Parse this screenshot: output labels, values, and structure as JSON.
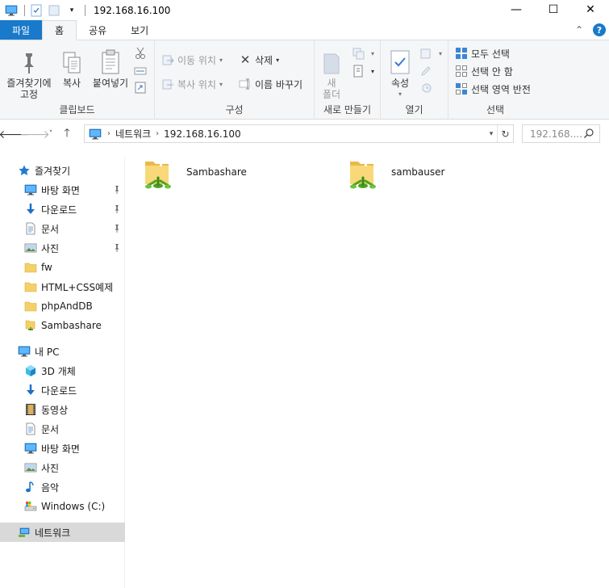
{
  "titlebar": {
    "title": "192.168.16.100",
    "minimize": "—",
    "maximize": "☐",
    "close": "✕"
  },
  "tabs": {
    "file": "파일",
    "home": "홈",
    "share": "공유",
    "view": "보기",
    "collapse": "⌃",
    "help": "?"
  },
  "ribbon": {
    "clipboard": {
      "label": "클립보드",
      "pin_line1": "즐겨찾기에",
      "pin_line2": "고정",
      "copy": "복사",
      "paste": "붙여넣기"
    },
    "organize": {
      "label": "구성",
      "move_to": "이동 위치",
      "copy_to": "복사 위치",
      "delete": "삭제",
      "rename": "이름 바꾸기"
    },
    "new": {
      "label": "새로 만들기",
      "new_folder_line1": "새",
      "new_folder_line2": "폴더"
    },
    "open": {
      "label": "열기",
      "properties": "속성"
    },
    "select": {
      "label": "선택",
      "select_all": "모두 선택",
      "select_none": "선택 안 함",
      "invert": "선택 영역 반전"
    }
  },
  "address": {
    "crumbs": [
      "네트워크",
      "192.168.16.100"
    ],
    "search_placeholder": "192.168...."
  },
  "navpane": {
    "quick_access": "즐겨찾기",
    "quick_items": [
      "바탕 화면",
      "다운로드",
      "문서",
      "사진",
      "fw",
      "HTML+CSS예제",
      "phpAndDB",
      "Sambashare"
    ],
    "this_pc": "내 PC",
    "pc_items": [
      "3D 개체",
      "다운로드",
      "동영상",
      "문서",
      "바탕 화면",
      "사진",
      "음악",
      "Windows (C:)"
    ],
    "network": "네트워크"
  },
  "content": {
    "items": [
      "Sambashare",
      "sambauser"
    ]
  },
  "colors": {
    "accent": "#1979ca",
    "folder": "#f5cf68",
    "selected": "#d9d9d9"
  }
}
